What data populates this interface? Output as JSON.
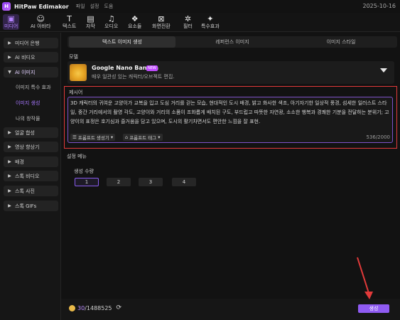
{
  "app": {
    "name": "HitPaw Edimakor",
    "menu": [
      "파일",
      "설정",
      "도움"
    ],
    "date": "2025-10-16"
  },
  "toolbar": {
    "items": [
      {
        "label": "미디어",
        "icon": "media-icon"
      },
      {
        "label": "AI 아바타",
        "icon": "ai-avatar-icon"
      },
      {
        "label": "텍스트",
        "icon": "text-icon"
      },
      {
        "label": "자막",
        "icon": "subtitle-icon"
      },
      {
        "label": "오디오",
        "icon": "audio-icon"
      },
      {
        "label": "요소들",
        "icon": "elements-icon"
      },
      {
        "label": "화면전환",
        "icon": "transition-icon"
      },
      {
        "label": "필터",
        "icon": "filter-icon"
      },
      {
        "label": "특수효과",
        "icon": "effects-icon"
      }
    ],
    "active": "미디어"
  },
  "sidebar": {
    "items": [
      {
        "label": "미디어 은행"
      },
      {
        "label": "AI 비디오"
      },
      {
        "label": "AI 이미지"
      },
      {
        "label": "얼굴 합성"
      },
      {
        "label": "영상 향상기"
      },
      {
        "label": "배경"
      },
      {
        "label": "스톡 비디오"
      },
      {
        "label": "스톡 사진"
      },
      {
        "label": "스톡 GIFs"
      }
    ],
    "subitems": [
      "이미지 특수 효과",
      "이미지 생성",
      "나의 창작물"
    ],
    "active_sub": "이미지 생성"
  },
  "tabs": [
    "텍스트 이미지 생성",
    "레퍼런스 이미지",
    "이미지 스타일"
  ],
  "model": {
    "section_label": "모델",
    "name": "Google Nano Banana",
    "badge": "NEW",
    "description": "매우 일관성 있는 캐릭터/오브젝트 편집."
  },
  "prompt": {
    "section_label": "제시어",
    "text": "3D 캐릭터의 귀여운 고양이가 교복을 입고 도심 거리를 걷는 모습, 현대적인 도시 배경, 밝고 화사한 색조, 아기자기한 일상적 풍경, 섬세한 일러스트 스타일, 중간 거리에서의 촬영 각도, 고양이와 거리의 소품이 조화롭게 배치된 구도, 부드럽고 따뜻한 자연광, 소소한 행복과 경쾌한 기분을 전달하는 분위기; 고양이의 표정은 호기심과 즐거움을 담고 있으며, 도시의 활기차면서도 편안한 느낌을 잘 표현.",
    "generator_button": "프롬프트 생성기",
    "tag_button": "프롬프트 태그",
    "char_count": "536",
    "char_max": "/2000"
  },
  "settings": {
    "section_label": "설정 메뉴",
    "count_label": "생성 수량",
    "counts": [
      "1",
      "2",
      "3",
      "4"
    ],
    "selected": "1"
  },
  "footer": {
    "credits_used": "30",
    "credits_total": "/1488525",
    "generate_label": "생성"
  },
  "colors": {
    "accent": "#8f5bf2",
    "highlight": "#e23a3a",
    "badge": "#c04bff"
  }
}
